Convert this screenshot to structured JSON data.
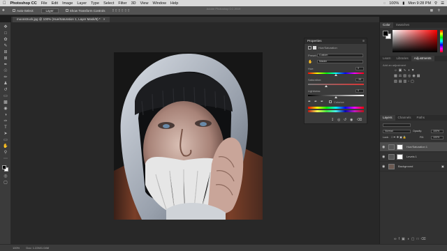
{
  "menubar": {
    "apple_icon": "apple-icon",
    "app_name": "Photoshop CC",
    "items": [
      "File",
      "Edit",
      "Image",
      "Layer",
      "Type",
      "Select",
      "Filter",
      "3D",
      "View",
      "Window",
      "Help"
    ],
    "battery": "100%",
    "clock": "Mon 9:28 PM"
  },
  "window_title": "Adobe Photoshop CC 2019",
  "options": {
    "auto_select": "Auto-Select:",
    "auto_select_value": "Layer",
    "show_transform": "Show Transform Controls"
  },
  "document": {
    "tab_label": "moonstruck.jpg @ 100% (Hue/Saturation 1, Layer Mask/8) *"
  },
  "status": {
    "zoom": "100%",
    "doc_info": "Doc: 1.22M/1.04M"
  },
  "properties": {
    "tab_label": "Properties",
    "adjustment_title": "Hue/Saturation",
    "preset_label": "Preset:",
    "preset_value": "Custom",
    "channel_value": "Master",
    "hue_label": "Hue:",
    "hue_value": "0",
    "hue_level": 0.5,
    "saturation_label": "Saturation:",
    "saturation_value": "-35",
    "saturation_level": 0.33,
    "lightness_label": "Lightness:",
    "lightness_value": "0",
    "lightness_level": 0.5,
    "colorize_label": "Colorize"
  },
  "color_panel": {
    "tabs": [
      "Color",
      "Swatches"
    ],
    "foreground": "#000000",
    "background": "#ffffff",
    "hue_base": "#ff0000"
  },
  "adjustments_panel": {
    "tabs": [
      "Learn",
      "Libraries",
      "Adjustments"
    ],
    "active_tab": "Adjustments",
    "hint": "Add an adjustment"
  },
  "layers_panel": {
    "tabs": [
      "Layers",
      "Channels",
      "Paths"
    ],
    "blend_mode": "Normal",
    "opacity_label": "Opacity:",
    "opacity_value": "100%",
    "lock_label": "Lock:",
    "fill_label": "Fill:",
    "fill_value": "100%",
    "layers": [
      {
        "name": "Hue/Saturation 1",
        "selected": true
      },
      {
        "name": "Levels 1",
        "selected": false
      },
      {
        "name": "Background",
        "selected": false
      }
    ]
  },
  "colors": {
    "ui_dark": "#323232",
    "ui_mid": "#3b3b3b",
    "selected_layer": "#4c4c4c"
  }
}
